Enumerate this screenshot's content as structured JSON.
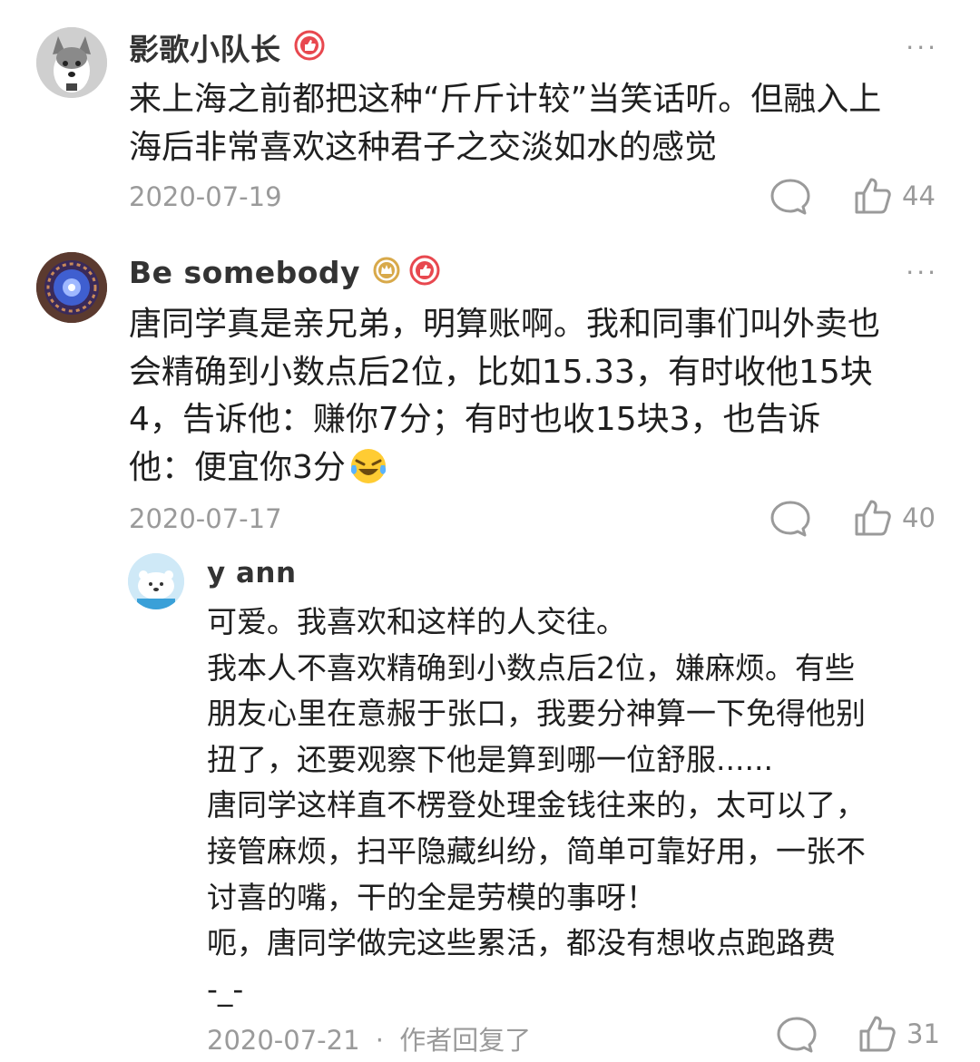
{
  "comments": [
    {
      "author": "影歌小队长",
      "text": "来上海之前都把这种“斤斤计较”当笑话听。但融入上\n海后非常喜欢这种君子之交淡如水的感觉",
      "date": "2020-07-19",
      "likes": "44",
      "more_label": "···"
    },
    {
      "author": "Be somebody",
      "text": "唐同学真是亲兄弟，明算账啊。我和同事们叫外卖也\n会精确到小数点后2位，比如15.33，有时收他15块\n4，告诉他：赚你7分；有时也收15块3，也告诉\n他：便宜你3分",
      "date": "2020-07-17",
      "likes": "40",
      "more_label": "···"
    }
  ],
  "reply": {
    "author": "y ann",
    "text": "可爱。我喜欢和这样的人交往。\n我本人不喜欢精确到小数点后2位，嫌麻烦。有些\n朋友心里在意赧于张口，我要分神算一下免得他别\n扭了，还要观察下他是算到哪一位舒服......\n唐同学这样直不楞登处理金钱往来的，太可以了，\n接管麻烦，扫平隐藏纠纷，简单可靠好用，一张不\n讨喜的嘴，干的全是劳模的事呀！\n呃，唐同学做完这些累活，都没有想收点跑路费\n-_-",
    "date": "2020-07-21",
    "separator": "·",
    "author_replied": "作者回复了",
    "likes": "31"
  },
  "icons": {
    "reply": "comment-bubble-icon",
    "like": "thumbs-up-icon",
    "badge_red": "thumbs-up-badge-icon",
    "badge_gold": "crown-badge-icon",
    "emoji": "laughing-crying-emoji-icon"
  },
  "colors": {
    "text": "#1f1f1f",
    "muted": "#9a9a9a",
    "badge_red": "#e8484f",
    "badge_gold": "#d8a94a"
  }
}
